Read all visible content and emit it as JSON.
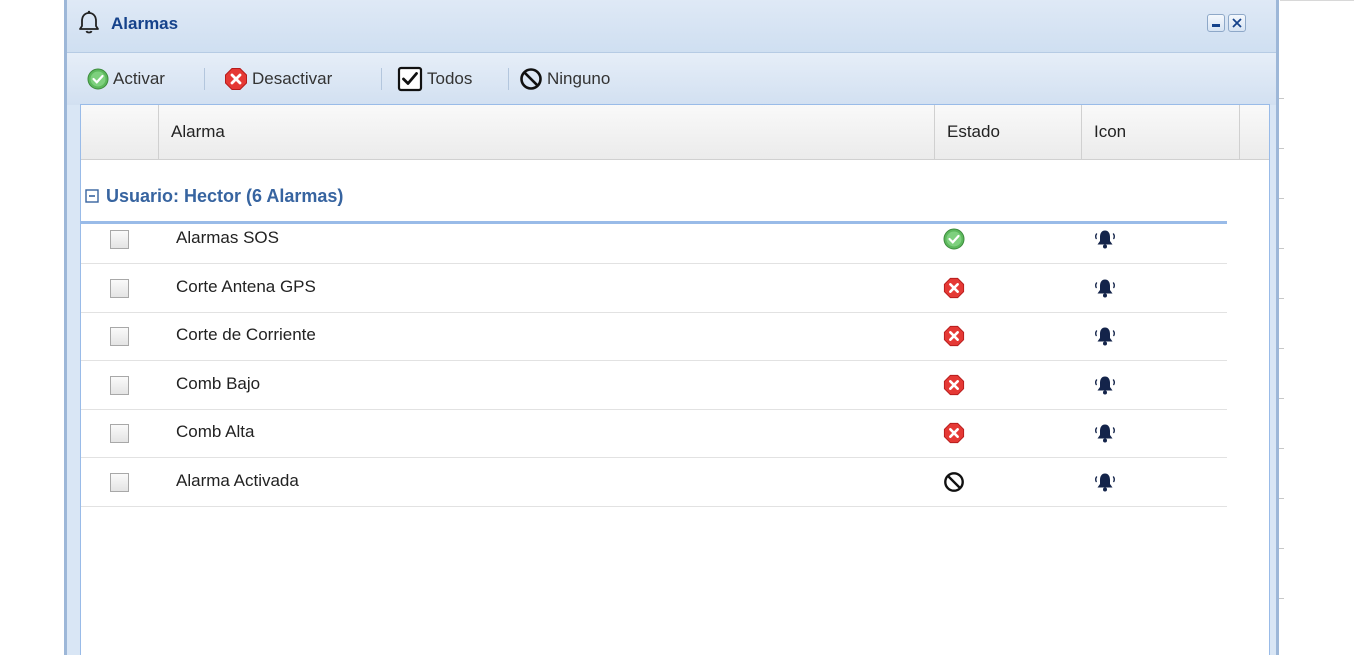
{
  "window": {
    "title": "Alarmas",
    "title_icon": "bell-outline-icon",
    "controls": [
      {
        "name": "minimize",
        "icon": "minimize-icon"
      },
      {
        "name": "close",
        "icon": "close-icon"
      }
    ]
  },
  "toolbar": {
    "activar": {
      "label": "Activar",
      "icon": "check-circle-green-icon"
    },
    "desactivar": {
      "label": "Desactivar",
      "icon": "x-circle-red-icon"
    },
    "todos": {
      "label": "Todos",
      "icon": "checkbox-checked-icon"
    },
    "ninguno": {
      "label": "Ninguno",
      "icon": "no-entry-icon"
    }
  },
  "grid": {
    "columns": [
      "",
      "Alarma",
      "Estado",
      "Icon"
    ],
    "group": {
      "label": "Usuario: Hector (6 Alarmas)",
      "expanded": true
    },
    "rows": [
      {
        "name": "Alarmas SOS",
        "estado": "active",
        "checked": false,
        "icon": "bell-icon"
      },
      {
        "name": "Corte Antena GPS",
        "estado": "inactive",
        "checked": false,
        "icon": "bell-icon"
      },
      {
        "name": "Corte de Corriente",
        "estado": "inactive",
        "checked": false,
        "icon": "bell-icon"
      },
      {
        "name": "Comb Bajo",
        "estado": "inactive",
        "checked": false,
        "icon": "bell-icon"
      },
      {
        "name": "Comb Alta",
        "estado": "inactive",
        "checked": false,
        "icon": "bell-icon"
      },
      {
        "name": "Alarma Activada",
        "estado": "none",
        "checked": false,
        "icon": "bell-icon"
      }
    ]
  },
  "colors": {
    "title_text": "#15428b",
    "group_text": "#3764a0",
    "active_green": "#4caf50",
    "inactive_red": "#e53935",
    "bell_navy": "#14244a"
  }
}
